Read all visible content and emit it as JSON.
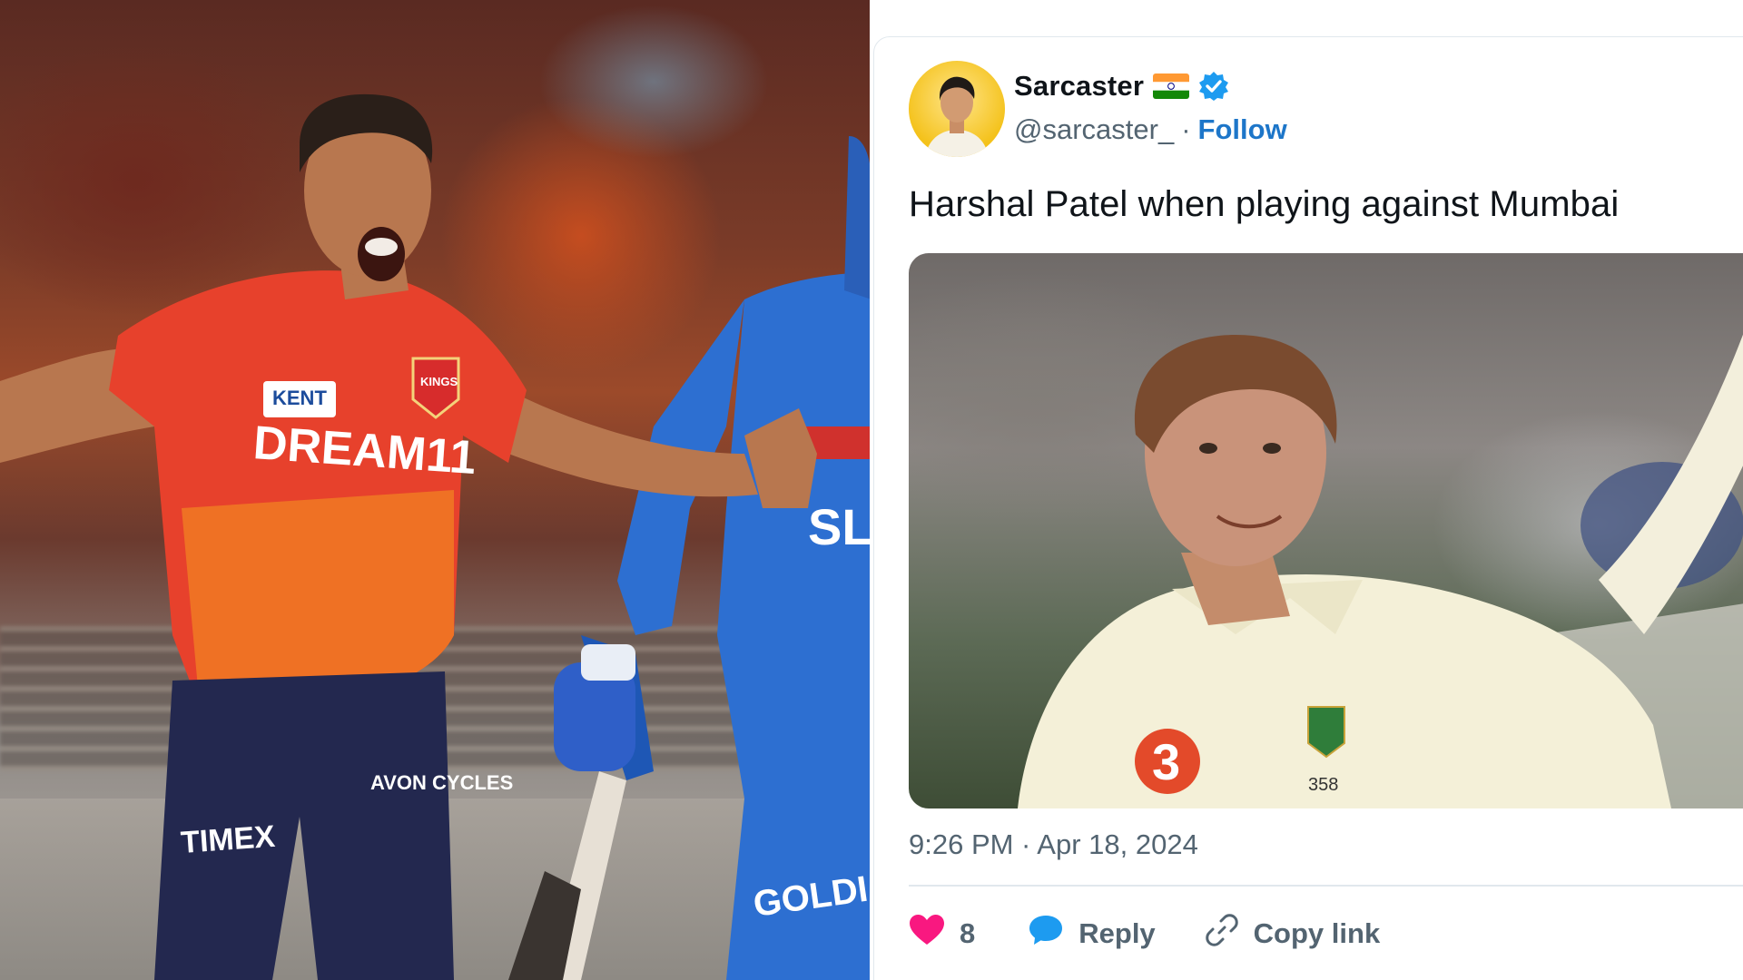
{
  "left_photo": {
    "jersey_text": "DREAM11",
    "sponsor_kent": "KENT",
    "sponsor_timex": "TIMEX",
    "sponsor_avon": "AVON CYCLES",
    "badge_text": "KINGS",
    "opponent_jersey_text": "GOLDI",
    "opponent_chest_text": "SL"
  },
  "tweet": {
    "display_name": "Sarcaster",
    "handle": "@sarcaster_",
    "separator": "·",
    "follow_label": "Follow",
    "text": "Harshal Patel when playing against Mumbai",
    "media_shirt_number": "358",
    "media_logo_text": "3",
    "timestamp": "9:26 PM · Apr 18, 2024",
    "like_count": "8",
    "reply_label": "Reply",
    "copy_link_label": "Copy link"
  },
  "icons": {
    "flag": "india-flag-icon",
    "verified": "verified-badge-icon",
    "like": "heart-icon",
    "reply": "speech-bubble-icon",
    "copy_link": "link-icon"
  },
  "colors": {
    "like_pink": "#f91880",
    "reply_blue": "#1d9bf0",
    "follow_blue": "#1d76c9",
    "text_primary": "#0f1419",
    "text_secondary": "#536471"
  }
}
